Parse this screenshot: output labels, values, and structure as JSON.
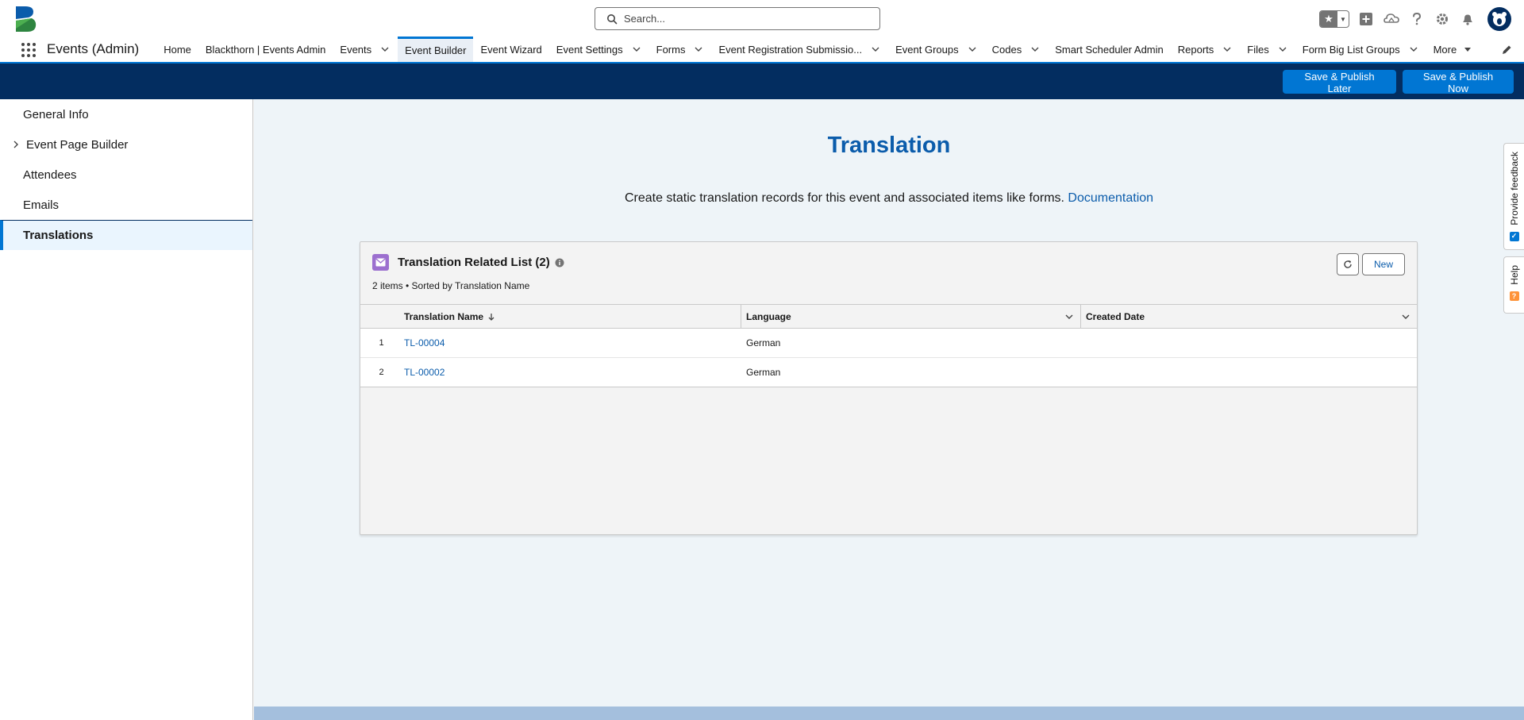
{
  "header": {
    "search_placeholder": "Search...",
    "icons": [
      "favorites-star-icon",
      "add-icon",
      "trailhead-icon",
      "help-icon",
      "setup-gear-icon",
      "notifications-bell-icon",
      "user-avatar"
    ]
  },
  "nav": {
    "app_name": "Events (Admin)",
    "items": [
      {
        "label": "Home",
        "dropdown": false
      },
      {
        "label": "Blackthorn | Events Admin",
        "dropdown": false
      },
      {
        "label": "Events",
        "dropdown": true
      },
      {
        "label": "Event Builder",
        "dropdown": false,
        "active": true
      },
      {
        "label": "Event Wizard",
        "dropdown": false
      },
      {
        "label": "Event Settings",
        "dropdown": true
      },
      {
        "label": "Forms",
        "dropdown": true
      },
      {
        "label": "Event Registration Submissio...",
        "dropdown": true
      },
      {
        "label": "Event Groups",
        "dropdown": true
      },
      {
        "label": "Codes",
        "dropdown": true
      },
      {
        "label": "Smart Scheduler Admin",
        "dropdown": false
      },
      {
        "label": "Reports",
        "dropdown": true
      },
      {
        "label": "Files",
        "dropdown": true
      },
      {
        "label": "Form Big List Groups",
        "dropdown": true
      },
      {
        "label": "More",
        "dropdown": true
      }
    ]
  },
  "toolbar": {
    "save_later_label": "Save & Publish Later",
    "save_now_label": "Save & Publish Now"
  },
  "sidebar": {
    "items": [
      {
        "label": "General Info"
      },
      {
        "label": "Event Page Builder",
        "expandable": true
      },
      {
        "label": "Attendees"
      },
      {
        "label": "Emails"
      },
      {
        "label": "Translations",
        "active": true
      }
    ]
  },
  "main": {
    "title": "Translation",
    "subtitle": "Create static translation records for this event and associated items like forms.",
    "doc_link": "Documentation"
  },
  "related_list": {
    "title": "Translation Related List (2)",
    "meta": "2 items • Sorted by Translation Name",
    "new_label": "New",
    "columns": {
      "name": "Translation Name",
      "language": "Language",
      "created_date": "Created Date"
    },
    "rows": [
      {
        "num": "1",
        "name": "TL-00004",
        "language": "German",
        "created_date": ""
      },
      {
        "num": "2",
        "name": "TL-00002",
        "language": "German",
        "created_date": ""
      }
    ]
  },
  "side_tabs": {
    "feedback_label": "Provide feedback",
    "help_label": "Help"
  },
  "colors": {
    "brand": "#0176d3",
    "navy": "#032d60",
    "title_blue": "#0b5cab",
    "list_icon_purple": "#9c6fcf"
  }
}
